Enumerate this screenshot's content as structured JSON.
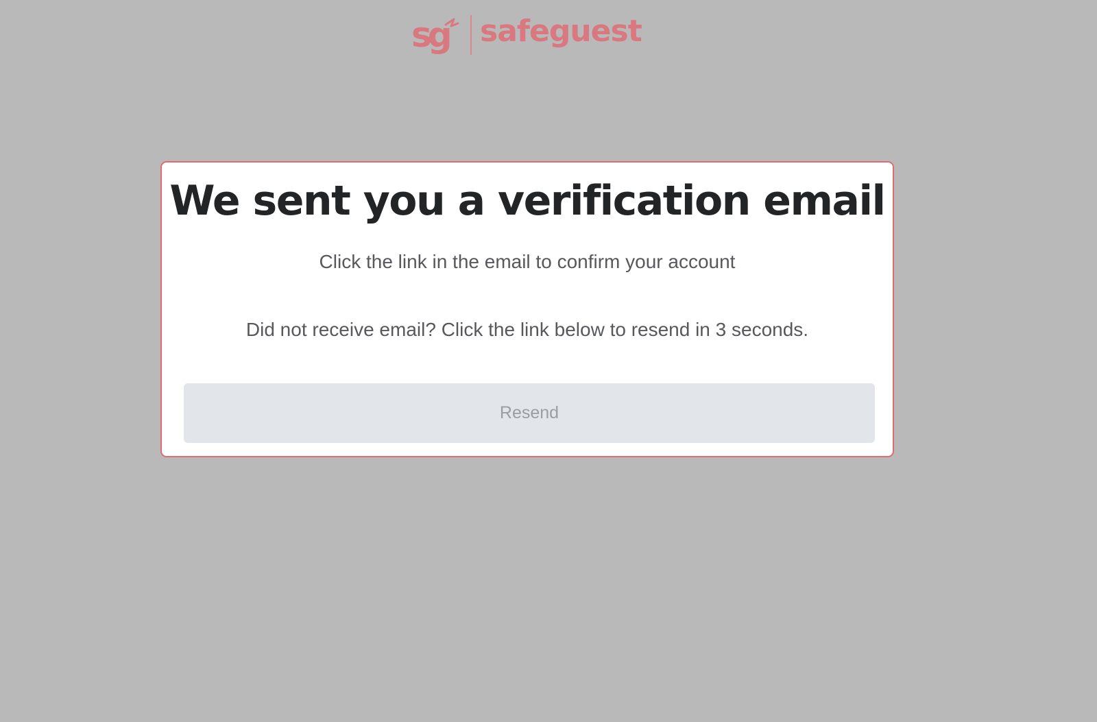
{
  "brand": {
    "name": "safeguest",
    "mark_icon": "sg-monogram-logo-icon",
    "color": "#d9787e"
  },
  "verification": {
    "title": "We sent you a verification email",
    "subtitle": "Click the link in the email to confirm your account",
    "resend_note": "Did not receive email? Click the link below to resend in 3 seconds.",
    "resend_label": "Resend",
    "resend_enabled": false
  },
  "colors": {
    "background": "#b9b9b9",
    "card_border": "#e06b73",
    "button_bg": "#e2e5ea",
    "button_text": "#9a9da2"
  }
}
